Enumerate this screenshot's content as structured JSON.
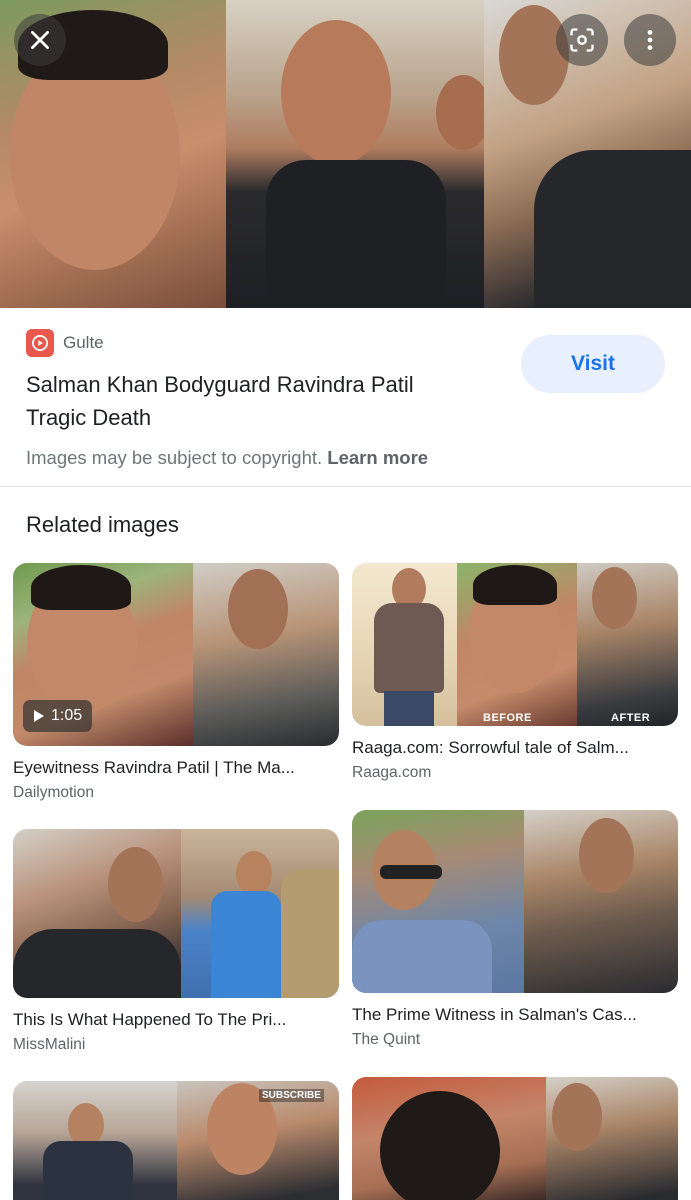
{
  "viewer": {
    "close_icon": "close-icon",
    "lens_icon": "lens-icon",
    "more_icon": "more-vert-icon"
  },
  "source": {
    "name": "Gulte",
    "logo_icon": "gulte-logo-icon",
    "logo_color": "#e8584d",
    "title_line1": "Salman Khan Bodyguard Ravindra Patil",
    "title_line2": "Tragic Death",
    "visit_label": "Visit",
    "copyright_text": "Images may be subject to copyright.",
    "learn_more": "Learn more"
  },
  "related": {
    "heading": "Related images",
    "items": [
      {
        "caption": "Eyewitness Ravindra Patil | The Ma...",
        "site": "Dailymotion",
        "duration": "1:05"
      },
      {
        "caption": "Raaga.com: Sorrowful tale of Salm...",
        "site": "Raaga.com",
        "before_label": "BEFORE",
        "after_label": "AFTER"
      },
      {
        "caption": "This Is What Happened To The Pri...",
        "site": "MissMalini"
      },
      {
        "caption": "The Prime Witness in Salman's Cas...",
        "site": "The Quint"
      },
      {
        "caption": "",
        "site": "",
        "badge": "SUBSCRIBE"
      },
      {
        "caption": "",
        "site": ""
      }
    ]
  },
  "colors": {
    "accent": "#1a73e8",
    "visit_bg": "#e8f0fe"
  }
}
